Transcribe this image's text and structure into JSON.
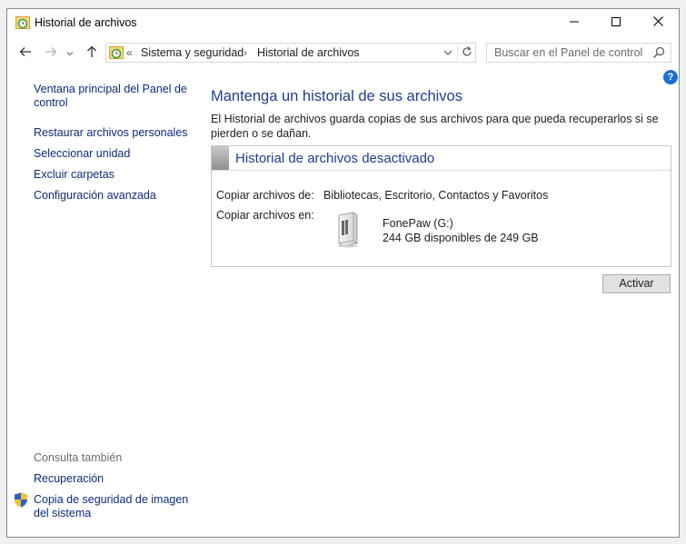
{
  "window": {
    "title": "Historial de archivos"
  },
  "icons": {
    "app": "file-history-icon",
    "minimize": "minimize-icon",
    "maximize": "maximize-icon",
    "close": "close-icon",
    "back": "back-arrow-icon",
    "forward": "forward-arrow-icon",
    "up": "up-arrow-icon",
    "refresh": "refresh-icon",
    "search": "search-icon",
    "help": "help-icon",
    "shield": "shield-icon",
    "drive": "external-drive-icon"
  },
  "addressbar": {
    "overflow": "«",
    "crumbs": [
      "Sistema y seguridad",
      "Historial de archivos"
    ],
    "separator": "›"
  },
  "search": {
    "placeholder": "Buscar en el Panel de control"
  },
  "help": {
    "label": "?"
  },
  "sidebar": {
    "links": [
      "Ventana principal del Panel de control",
      "Restaurar archivos personales",
      "Seleccionar unidad",
      "Excluir carpetas",
      "Configuración avanzada"
    ],
    "see_also_title": "Consulta también",
    "see_also": [
      "Recuperación",
      "Copia de seguridad de imagen del sistema"
    ]
  },
  "main": {
    "heading": "Mantenga un historial de sus archivos",
    "description": "El Historial de archivos guarda copias de sus archivos para que pueda recuperarlos si se pierden o se dañan.",
    "status_title": "Historial de archivos desactivado",
    "copy_from_label": "Copiar archivos de:",
    "copy_from_value": "Bibliotecas, Escritorio, Contactos y Favoritos",
    "copy_to_label": "Copiar archivos en:",
    "drive_name": "FonePaw (G:)",
    "drive_space": "244 GB disponibles de 249 GB",
    "activate_button": "Activar"
  },
  "colors": {
    "link": "#0b2c7a",
    "heading": "#1e3d8f",
    "help_badge": "#1e6fd2"
  }
}
